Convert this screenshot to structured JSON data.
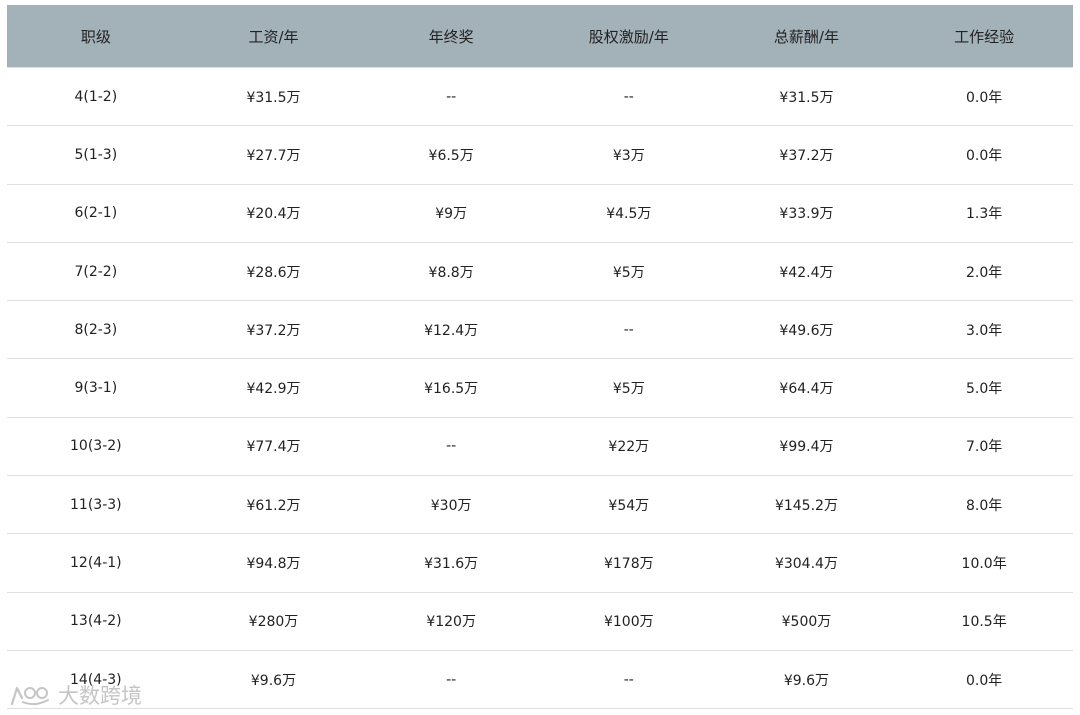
{
  "table": {
    "headers": [
      "职级",
      "工资/年",
      "年终奖",
      "股权激励/年",
      "总薪酬/年",
      "工作经验"
    ],
    "rows": [
      [
        "4(1-2)",
        "¥31.5万",
        "--",
        "--",
        "¥31.5万",
        "0.0年"
      ],
      [
        "5(1-3)",
        "¥27.7万",
        "¥6.5万",
        "¥3万",
        "¥37.2万",
        "0.0年"
      ],
      [
        "6(2-1)",
        "¥20.4万",
        "¥9万",
        "¥4.5万",
        "¥33.9万",
        "1.3年"
      ],
      [
        "7(2-2)",
        "¥28.6万",
        "¥8.8万",
        "¥5万",
        "¥42.4万",
        "2.0年"
      ],
      [
        "8(2-3)",
        "¥37.2万",
        "¥12.4万",
        "--",
        "¥49.6万",
        "3.0年"
      ],
      [
        "9(3-1)",
        "¥42.9万",
        "¥16.5万",
        "¥5万",
        "¥64.4万",
        "5.0年"
      ],
      [
        "10(3-2)",
        "¥77.4万",
        "--",
        "¥22万",
        "¥99.4万",
        "7.0年"
      ],
      [
        "11(3-3)",
        "¥61.2万",
        "¥30万",
        "¥54万",
        "¥145.2万",
        "8.0年"
      ],
      [
        "12(4-1)",
        "¥94.8万",
        "¥31.6万",
        "¥178万",
        "¥304.4万",
        "10.0年"
      ],
      [
        "13(4-2)",
        "¥280万",
        "¥120万",
        "¥100万",
        "¥500万",
        "10.5年"
      ],
      [
        "14(4-3)",
        "¥9.6万",
        "--",
        "--",
        "¥9.6万",
        "0.0年"
      ]
    ]
  },
  "watermark": {
    "text": "大数跨境",
    "icon": "brand-logo-icon"
  }
}
